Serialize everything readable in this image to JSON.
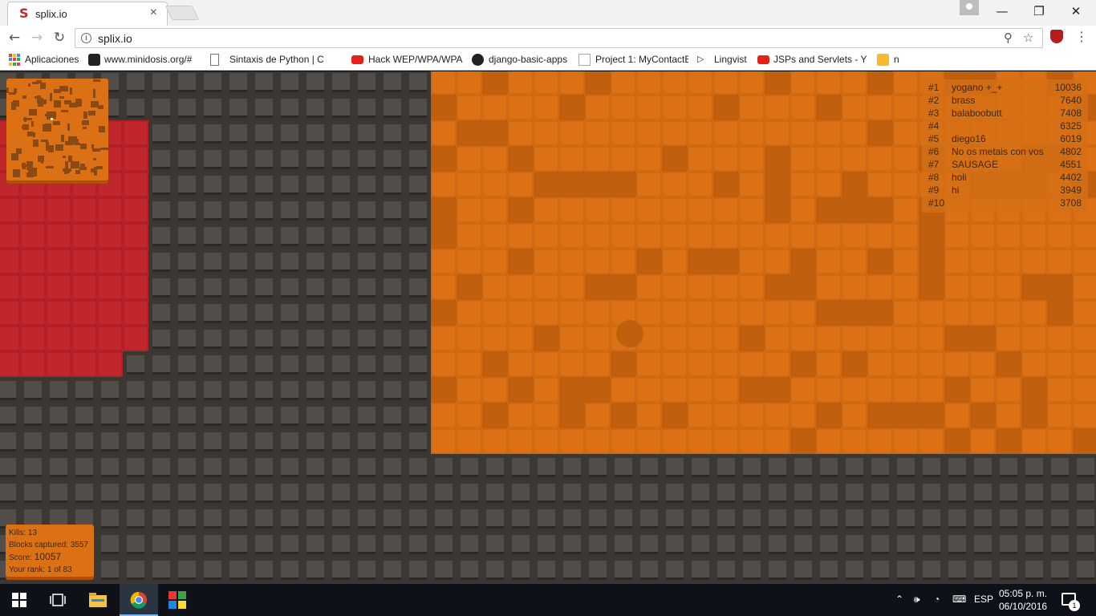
{
  "browser": {
    "tab_title": "splix.io",
    "tab_favicon": "S",
    "close_tab": "×",
    "url": "splix.io",
    "window_controls": {
      "minimize": "—",
      "maximize": "❐",
      "close": "✕"
    },
    "nav": {
      "back": "←",
      "forward": "→",
      "reload": "↻",
      "menu": "⋮",
      "zoom_icon": "⚲",
      "star_icon": "☆",
      "info": "i"
    },
    "bookmarks": [
      {
        "label": "Aplicaciones",
        "icon": "apps-icon"
      },
      {
        "label": "www.minidosis.org/#",
        "icon": "minidosis-icon"
      },
      {
        "label": "Sintaxis de Python | C",
        "icon": "page-icon"
      },
      {
        "label": "Hack WEP/WPA/WPA",
        "icon": "youtube-icon"
      },
      {
        "label": "django-basic-apps",
        "icon": "github-icon"
      },
      {
        "label": "Project 1: MyContactB",
        "icon": "project-icon"
      },
      {
        "label": "Lingvist",
        "icon": "lingvist-icon"
      },
      {
        "label": "JSPs and Servlets - You",
        "icon": "youtube-icon"
      },
      {
        "label": "n",
        "icon": "go-icon"
      }
    ]
  },
  "leaderboard": [
    {
      "rank": "#1",
      "name": "yogano +_+",
      "score": "10036"
    },
    {
      "rank": "#2",
      "name": "brass",
      "score": "7640"
    },
    {
      "rank": "#3",
      "name": "balaboobutt",
      "score": "7408"
    },
    {
      "rank": "#4",
      "name": "",
      "score": "6325"
    },
    {
      "rank": "#5",
      "name": "diego16",
      "score": "6019"
    },
    {
      "rank": "#6",
      "name": "No os metais con vos",
      "score": "4802"
    },
    {
      "rank": "#7",
      "name": "SAUSAGE",
      "score": "4551"
    },
    {
      "rank": "#8",
      "name": "holi",
      "score": "4402"
    },
    {
      "rank": "#9",
      "name": "hi",
      "score": "3949"
    },
    {
      "rank": "#10",
      "name": "",
      "score": "3708"
    }
  ],
  "stats": {
    "kills_label": "Kills:",
    "kills": "13",
    "blocks_label": "Blocks captured:",
    "blocks": "3557",
    "score_label": "Score:",
    "score": "10057",
    "rank_label": "Your rank:",
    "rank": "1 of 83"
  },
  "colors": {
    "grid_bg": "#3b3733",
    "grid_tile": "#524d48",
    "player": "#dc7015",
    "player_dark": "#c0600f",
    "enemy": "#c0262c"
  },
  "taskbar": {
    "lang": "ESP",
    "time": "05:05 p. m.",
    "date": "06/10/2016",
    "notifications": "1"
  }
}
